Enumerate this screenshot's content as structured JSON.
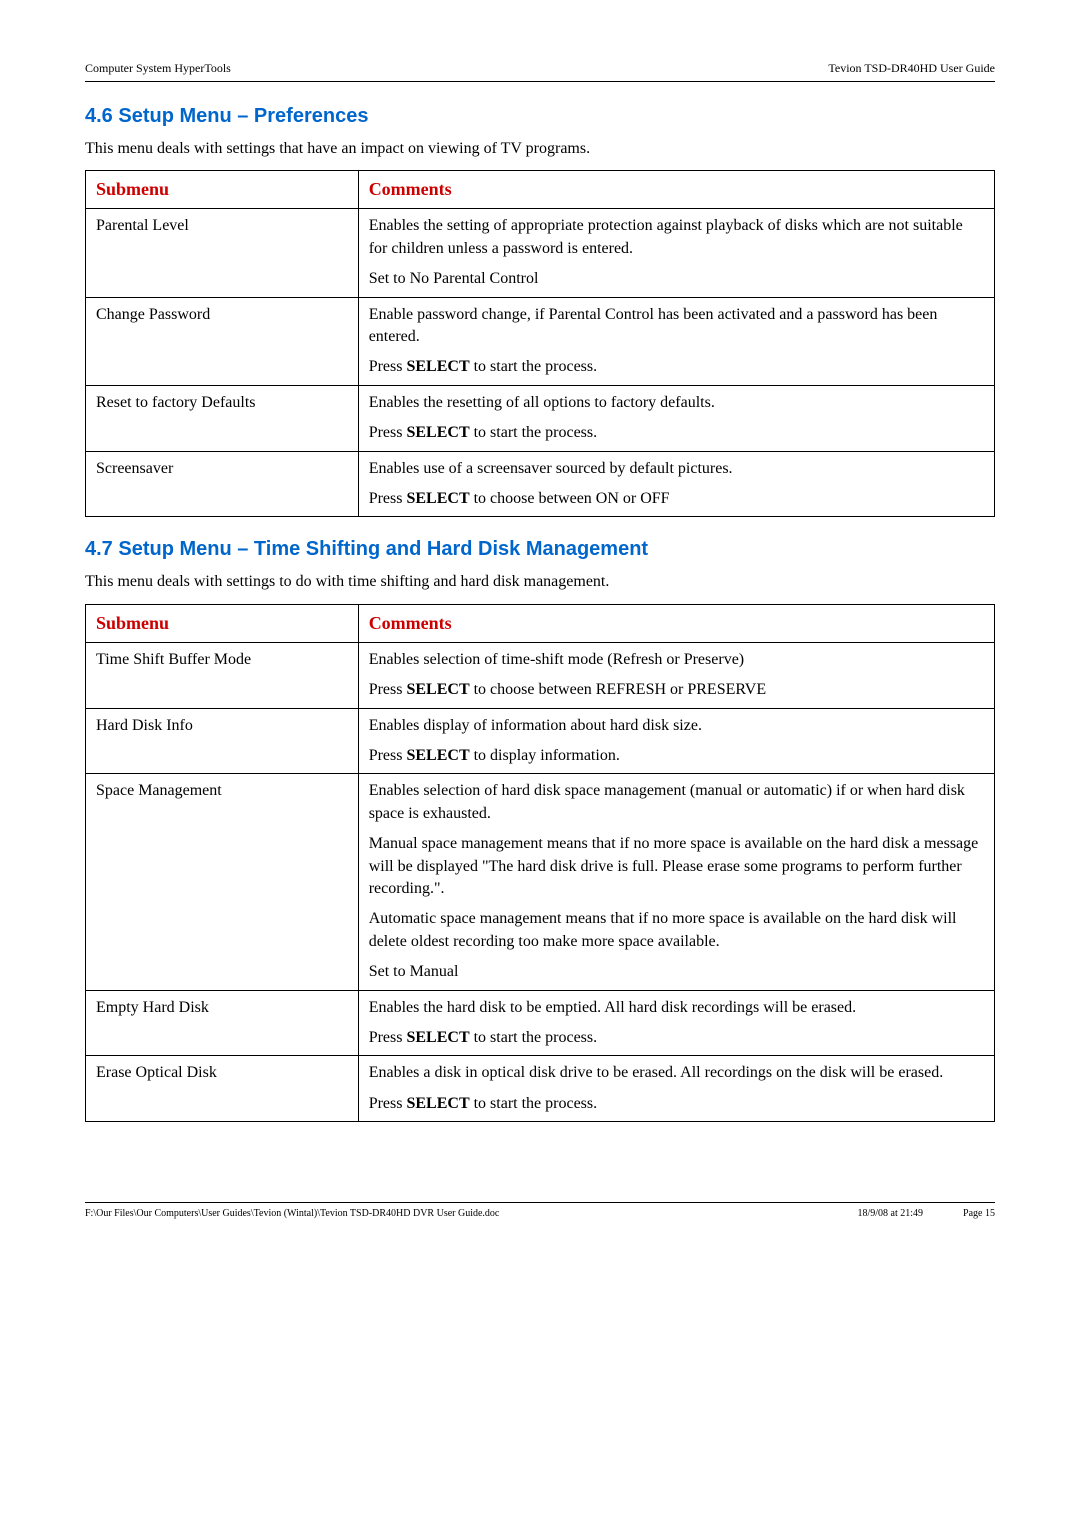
{
  "header": {
    "left": "Computer System HyperTools",
    "right": "Tevion TSD-DR40HD User Guide"
  },
  "section1": {
    "heading": "4.6  Setup Menu – Preferences",
    "intro": "This menu deals with settings that have an impact on viewing of TV programs.",
    "col1": "Submenu",
    "col2": "Comments",
    "rows": [
      {
        "submenu": "Parental Level",
        "p1": "Enables the setting of appropriate protection against playback of disks which are not suitable for children unless a password is entered.",
        "p2": "Set to No Parental Control"
      },
      {
        "submenu": "Change Password",
        "p1": "Enable password change, if Parental Control has been activated and a password has been entered.",
        "p2a": "Press ",
        "p2b": "SELECT",
        "p2c": " to start the process."
      },
      {
        "submenu": "Reset to factory Defaults",
        "p1": "Enables the resetting of all options to factory defaults.",
        "p2a": "Press ",
        "p2b": "SELECT",
        "p2c": " to start the process."
      },
      {
        "submenu": "Screensaver",
        "p1": "Enables use of a screensaver sourced by default pictures.",
        "p2a": "Press ",
        "p2b": "SELECT",
        "p2c": " to choose between ON or OFF"
      }
    ]
  },
  "section2": {
    "heading": "4.7  Setup Menu – Time Shifting and Hard Disk Management",
    "intro": "This menu deals with settings to do with time shifting and hard disk management.",
    "col1": "Submenu",
    "col2": "Comments",
    "rows": [
      {
        "submenu": "Time Shift Buffer Mode",
        "p1": "Enables selection of time-shift mode (Refresh or Preserve)",
        "p2a": "Press ",
        "p2b": "SELECT",
        "p2c": " to choose between REFRESH or PRESERVE"
      },
      {
        "submenu": "Hard Disk Info",
        "p1": "Enables display of information about hard disk size.",
        "p2a": "Press ",
        "p2b": "SELECT",
        "p2c": " to display information."
      },
      {
        "submenu": "Space Management",
        "p1": "Enables selection of hard disk space management (manual or automatic) if or when hard disk space is exhausted.",
        "p2": "Manual space management means that if no more space is available on the hard disk a message will be displayed \"The hard disk drive is full. Please erase some programs to perform further recording.\".",
        "p3": "Automatic space management means that if no more space is available on the hard disk will delete oldest recording too make more space available.",
        "p4": "Set to Manual"
      },
      {
        "submenu": "Empty Hard Disk",
        "p1": "Enables the hard disk to be emptied. All hard disk recordings will be erased.",
        "p2a": "Press ",
        "p2b": "SELECT",
        "p2c": " to start the process."
      },
      {
        "submenu": "Erase Optical Disk",
        "p1": "Enables a disk in optical disk drive to be erased. All recordings on the disk will be erased.",
        "p2a": "Press ",
        "p2b": "SELECT",
        "p2c": " to start the process."
      }
    ]
  },
  "footer": {
    "left": "F:\\Our Files\\Our Computers\\User Guides\\Tevion (Wintal)\\Tevion TSD-DR40HD DVR User Guide.doc",
    "center": "18/9/08 at 21:49",
    "right": "Page 15"
  }
}
